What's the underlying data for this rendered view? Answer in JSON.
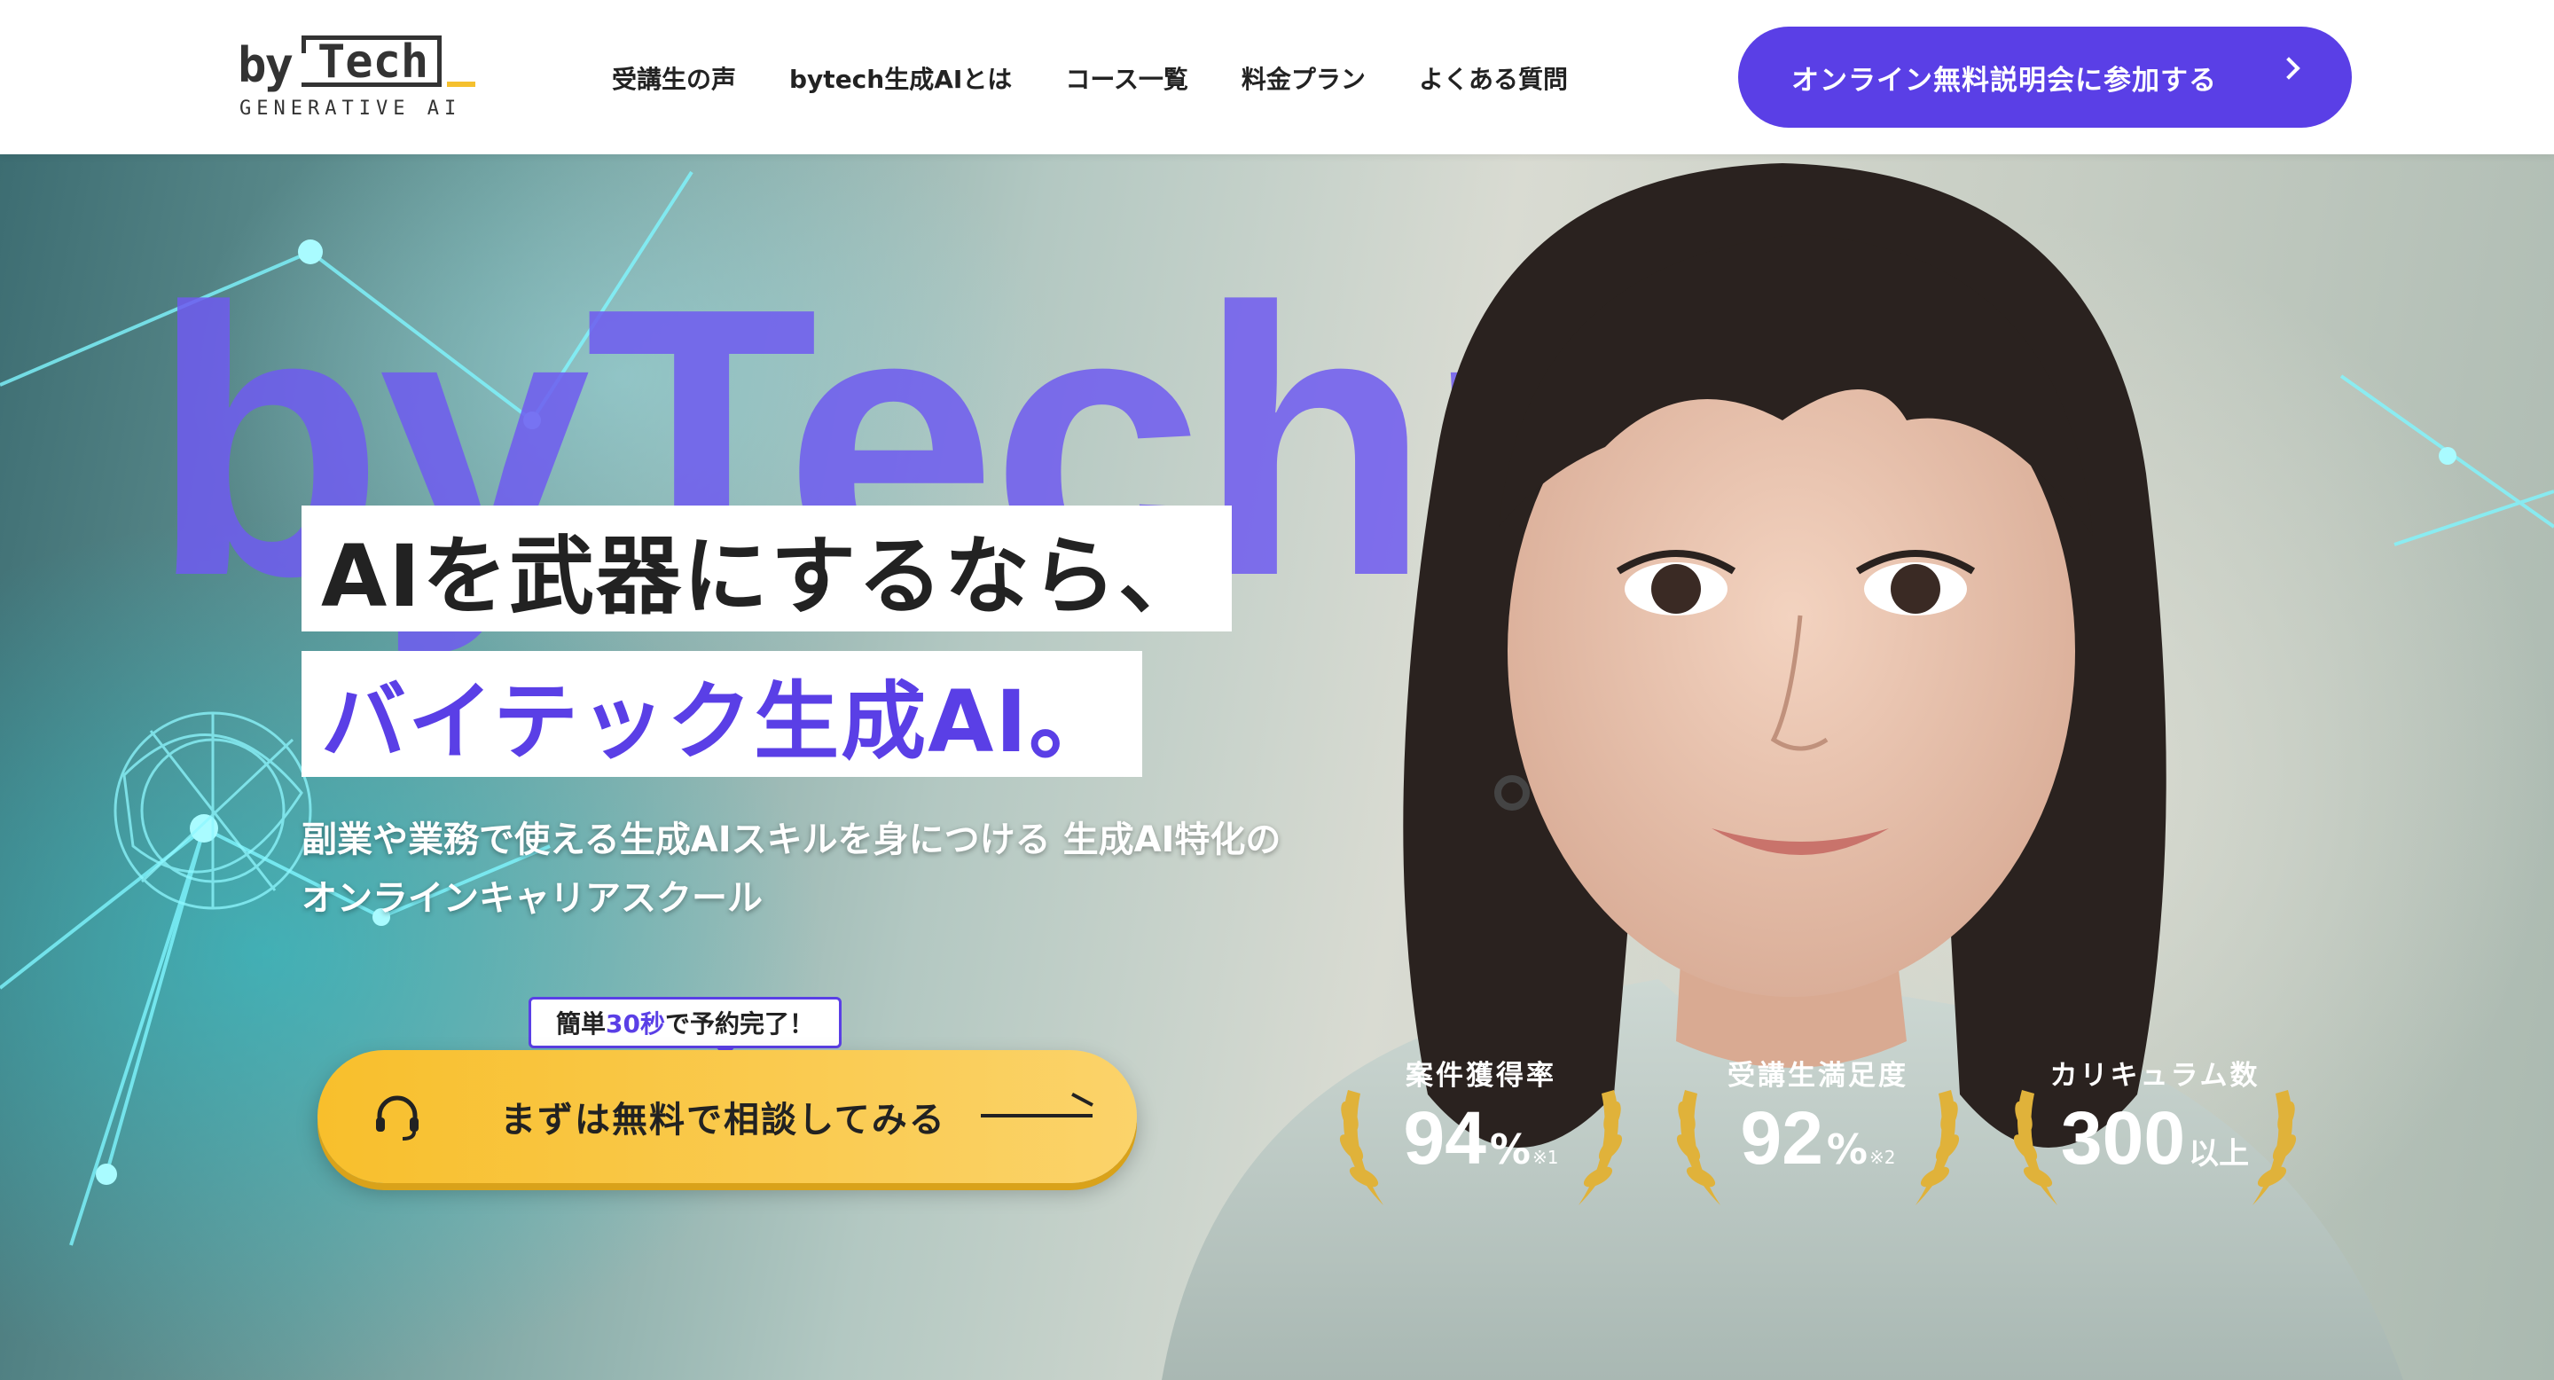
{
  "brand": {
    "by": "by",
    "tech": "Tech",
    "sub": "GENERATIVE AI"
  },
  "nav": {
    "items": [
      "受講生の声",
      "bytech生成AIとは",
      "コース一覧",
      "料金プラン",
      "よくある質問"
    ]
  },
  "header_cta": {
    "label": "オンライン無料説明会に参加する"
  },
  "hero": {
    "background_text": "byTechn",
    "headline_line1": "AIを武器にするなら、",
    "headline_line2": "バイテック生成AI。",
    "subtitle_line1": "副業や業務で使える生成AIスキルを身につける 生成AI特化の",
    "subtitle_line2": "オンラインキャリアスクール",
    "speech_badge": {
      "pre": "簡単",
      "highlight": "30秒",
      "post": "で予約完了！"
    },
    "main_cta": {
      "label": "まずは無料で相談してみる"
    }
  },
  "stats": [
    {
      "label": "案件獲得率",
      "value": "94",
      "unit": "%",
      "note": "※1"
    },
    {
      "label": "受講生満足度",
      "value": "92",
      "unit": "%",
      "note": "※2"
    },
    {
      "label": "カリキュラム数",
      "value": "300",
      "unit": "以上",
      "note": ""
    }
  ],
  "colors": {
    "accent": "#5a3fe6",
    "cta_yellow": "#f8bf2c",
    "gold": "#d9a21a"
  }
}
